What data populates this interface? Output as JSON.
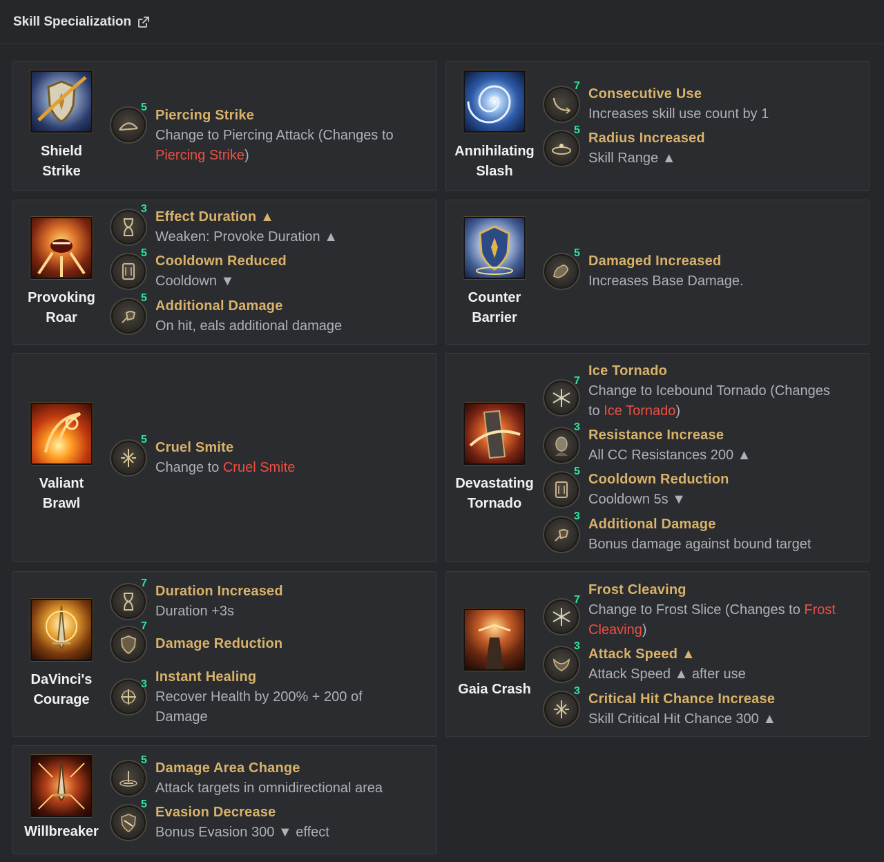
{
  "header": {
    "title": "Skill Specialization",
    "link_icon": "external-link-icon"
  },
  "colors": {
    "background": "#25272b",
    "card": "#2a2c30",
    "tripod_title": "#d9b26a",
    "tripod_level": "#2de6a0",
    "highlight": "#ee4f42"
  },
  "skills": [
    {
      "name_l1": "Shield",
      "name_l2": "Strike",
      "icon": "shield-strike-icon",
      "tripods": [
        {
          "level": "5",
          "icon": "piercing-icon",
          "title": "Piercing Strike",
          "desc_a": "Change to Piercing Attack (Changes to",
          "desc_b_red": "Piercing Strike",
          "desc_b_tail": ")"
        }
      ]
    },
    {
      "name_l1": "Annihilating",
      "name_l2": "Slash",
      "icon": "annihilating-slash-icon",
      "tripods": [
        {
          "level": "7",
          "icon": "consecutive-icon",
          "title": "Consecutive Use",
          "desc": "Increases skill use count by 1"
        },
        {
          "level": "5",
          "icon": "radius-icon",
          "title": "Radius Increased",
          "desc": "Skill Range ▲"
        }
      ]
    },
    {
      "name_l1": "Provoking",
      "name_l2": "Roar",
      "icon": "provoking-roar-icon",
      "tripods": [
        {
          "level": "3",
          "icon": "hourglass-icon",
          "title": "Effect Duration ▲",
          "desc": "Weaken: Provoke Duration ▲"
        },
        {
          "level": "5",
          "icon": "scroll-icon",
          "title": "Cooldown Reduced",
          "desc": "Cooldown ▼"
        },
        {
          "level": "5",
          "icon": "fist-icon",
          "title": "Additional Damage",
          "desc": "On hit, eals additional damage"
        }
      ]
    },
    {
      "name_l1": "Counter",
      "name_l2": "Barrier",
      "icon": "counter-barrier-icon",
      "tripods": [
        {
          "level": "5",
          "icon": "muscle-icon",
          "title": "Damaged Increased",
          "desc": "Increases Base Damage."
        }
      ]
    },
    {
      "name_l1": "Valiant",
      "name_l2": "Brawl",
      "icon": "valiant-brawl-icon",
      "tripods": [
        {
          "level": "5",
          "icon": "burst-icon",
          "title": "Cruel Smite",
          "desc_a": "Change to ",
          "desc_a_red": "Cruel Smite"
        }
      ]
    },
    {
      "name_l1": "Devastating",
      "name_l2": "Tornado",
      "icon": "devastating-tornado-icon",
      "tripods": [
        {
          "level": "7",
          "icon": "snowflake-icon",
          "title": "Ice Tornado",
          "desc_a": "Change to Icebound Tornado (Changes",
          "desc_b": "to ",
          "desc_b_red": "Ice Tornado",
          "desc_b_tail": ")"
        },
        {
          "level": "3",
          "icon": "head-icon",
          "title": "Resistance Increase",
          "desc": "All CC Resistances 200 ▲"
        },
        {
          "level": "5",
          "icon": "scroll-icon",
          "title": "Cooldown Reduction",
          "desc": "Cooldown 5s ▼"
        },
        {
          "level": "3",
          "icon": "fist-icon",
          "title": "Additional Damage",
          "desc": "Bonus damage against bound target"
        }
      ]
    },
    {
      "name_l1": "DaVinci's",
      "name_l2": "Courage",
      "icon": "davincis-courage-icon",
      "tripods": [
        {
          "level": "7",
          "icon": "hourglass-icon",
          "title": "Duration Increased",
          "desc": "Duration +3s"
        },
        {
          "level": "7",
          "icon": "shield-icon",
          "title": "Damage Reduction",
          "desc": ""
        },
        {
          "level": "3",
          "icon": "healing-icon",
          "title": "Instant Healing",
          "desc_a": "Recover Health by 200% + 200 of",
          "desc_b": "Damage"
        }
      ]
    },
    {
      "name_l1": "Gaia Crash",
      "name_l2": "",
      "icon": "gaia-crash-icon",
      "tripods": [
        {
          "level": "7",
          "icon": "snowflake-icon",
          "title": "Frost Cleaving",
          "desc_a": "Change to Frost Slice (Changes to ",
          "desc_a_red": "Frost",
          "desc_b_red": "Cleaving",
          "desc_b_tail": ")"
        },
        {
          "level": "3",
          "icon": "wings-icon",
          "title": "Attack Speed ▲",
          "desc": "Attack Speed ▲ after use"
        },
        {
          "level": "3",
          "icon": "burst-icon",
          "title": "Critical Hit Chance Increase",
          "desc": "Skill Critical Hit Chance 300 ▲"
        }
      ]
    },
    {
      "name_l1": "Willbreaker",
      "name_l2": "",
      "icon": "willbreaker-icon",
      "tripods": [
        {
          "level": "5",
          "icon": "area-icon",
          "title": "Damage Area Change",
          "desc": "Attack targets in omnidirectional area"
        },
        {
          "level": "5",
          "icon": "evasion-icon",
          "title": "Evasion Decrease",
          "desc": "Bonus Evasion 300 ▼ effect"
        }
      ]
    }
  ]
}
